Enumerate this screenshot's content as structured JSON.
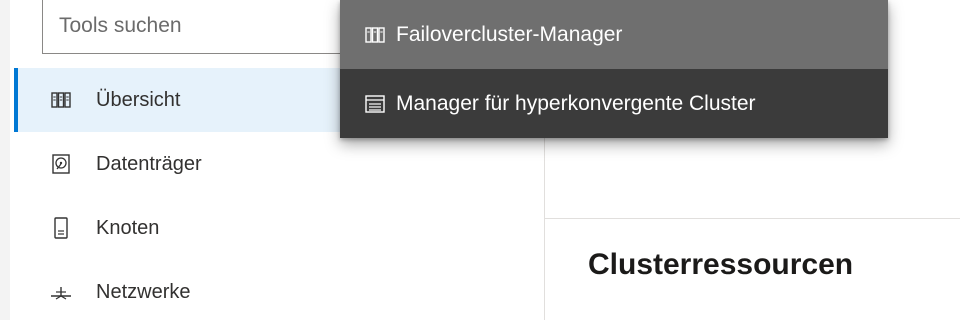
{
  "search": {
    "placeholder": "Tools suchen"
  },
  "sidebar": {
    "items": [
      {
        "label": "Übersicht",
        "icon": "overview-icon",
        "active": true
      },
      {
        "label": "Datenträger",
        "icon": "disk-icon",
        "active": false
      },
      {
        "label": "Knoten",
        "icon": "node-icon",
        "active": false
      },
      {
        "label": "Netzwerke",
        "icon": "network-icon",
        "active": false
      }
    ]
  },
  "dropdown": {
    "items": [
      {
        "label": "Failovercluster-Manager",
        "icon": "failover-cluster-icon"
      },
      {
        "label": "Manager für hyperkonvergente Cluster",
        "icon": "hyperconverged-cluster-icon"
      }
    ]
  },
  "main": {
    "section_title": "Clusterressourcen"
  },
  "colors": {
    "accent": "#0078d4",
    "active_bg": "#e6f2fb",
    "menu_bg": "#3b3b3b",
    "menu_hover": "#6f6f6f"
  }
}
